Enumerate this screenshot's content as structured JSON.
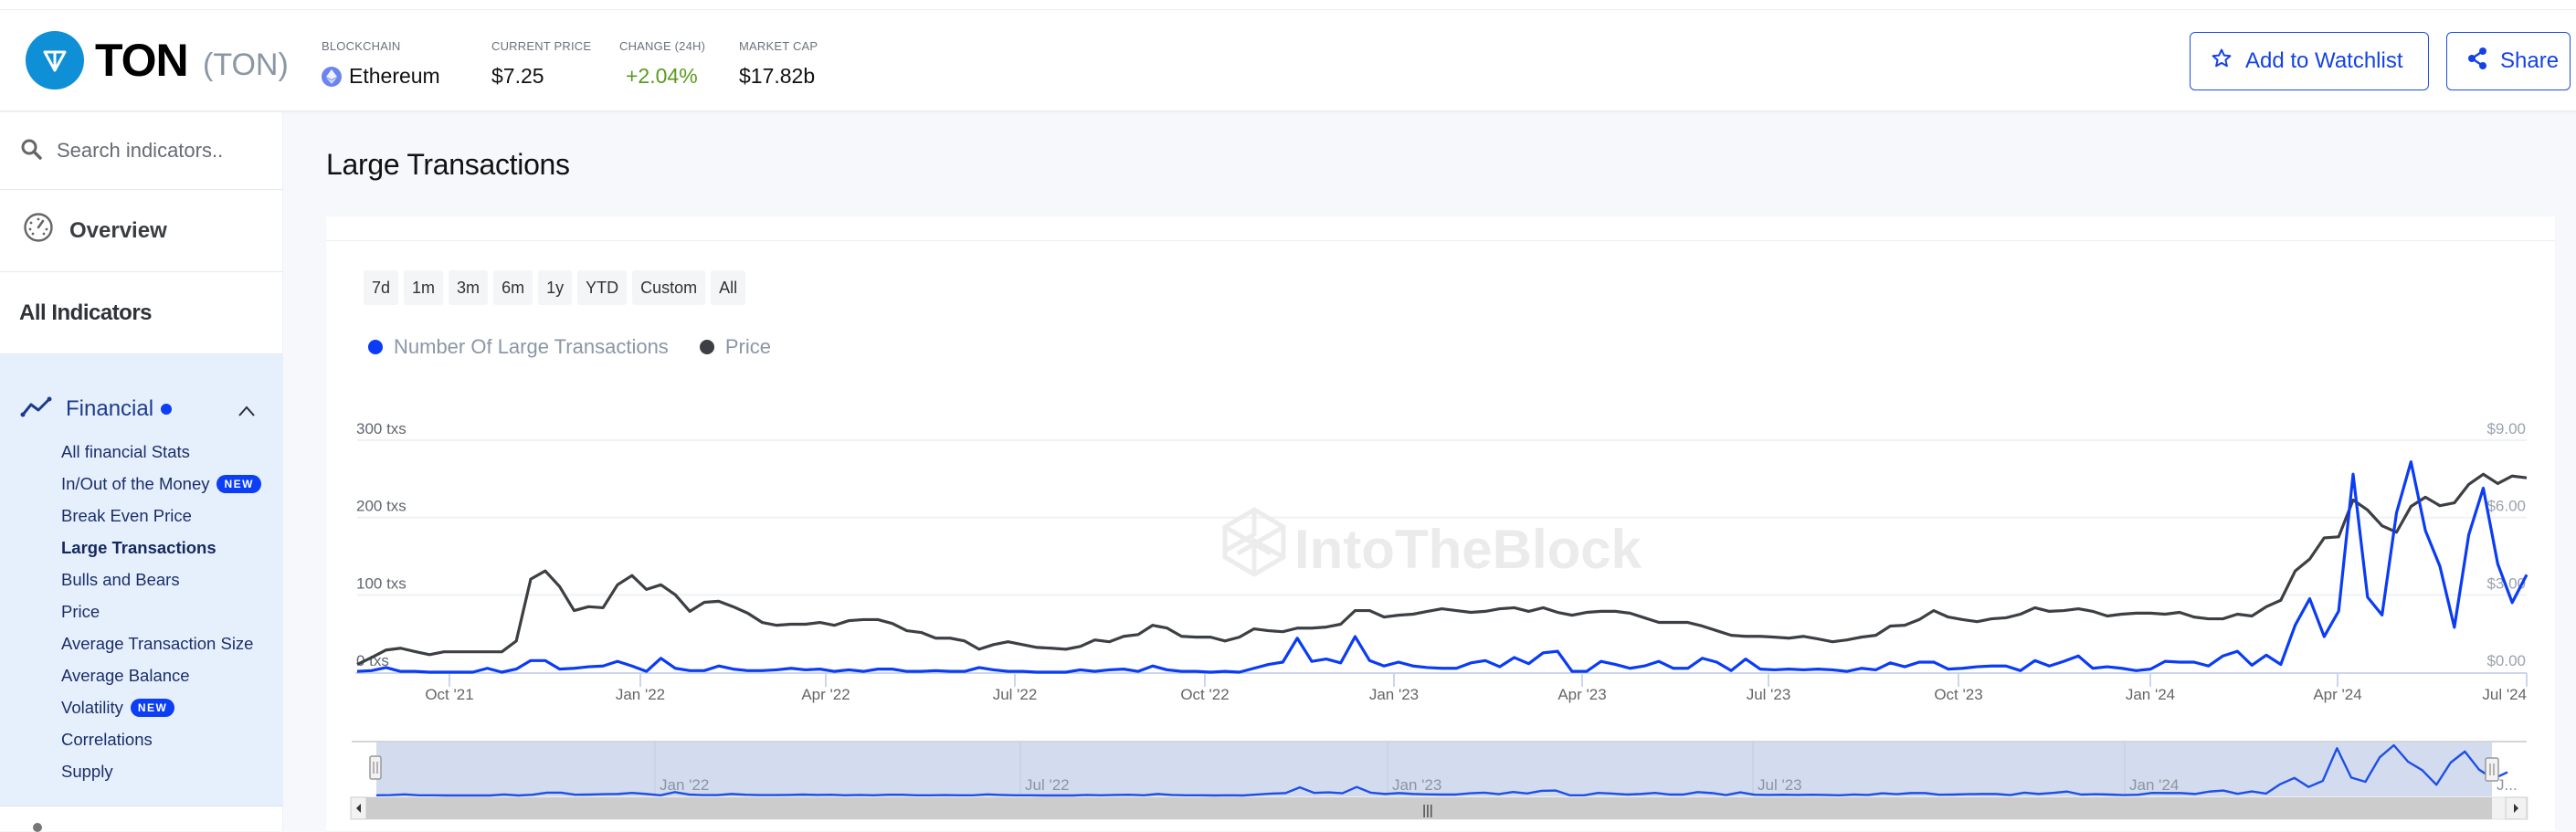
{
  "header": {
    "coin_name": "TON",
    "coin_ticker": "(TON)",
    "stats": [
      {
        "label": "BLOCKCHAIN",
        "value": "Ethereum",
        "icon": "ethereum-icon"
      },
      {
        "label": "CURRENT PRICE",
        "value": "$7.25"
      },
      {
        "label": "CHANGE (24H)",
        "value": "+2.04%",
        "color": "#5b9a1e"
      },
      {
        "label": "MARKET CAP",
        "value": "$17.82b"
      }
    ],
    "watchlist_label": "Add to Watchlist",
    "share_label": "Share",
    "accent": "#1442e6"
  },
  "sidebar": {
    "search_placeholder": "Search indicators..",
    "overview_label": "Overview",
    "all_indicators_label": "All Indicators",
    "group": {
      "label": "Financial",
      "expanded": true,
      "items": [
        {
          "label": "All financial Stats"
        },
        {
          "label": "In/Out of the Money",
          "badge": "NEW"
        },
        {
          "label": "Break Even Price"
        },
        {
          "label": "Large Transactions",
          "active": true
        },
        {
          "label": "Bulls and Bears"
        },
        {
          "label": "Price"
        },
        {
          "label": "Average Transaction Size"
        },
        {
          "label": "Average Balance"
        },
        {
          "label": "Volatility",
          "badge": "NEW"
        },
        {
          "label": "Correlations"
        },
        {
          "label": "Supply"
        }
      ]
    }
  },
  "main": {
    "title": "Large Transactions",
    "ranges": [
      "7d",
      "1m",
      "3m",
      "6m",
      "1y",
      "YTD",
      "Custom",
      "All"
    ],
    "watermark": "IntoTheBlock"
  },
  "chart_data": {
    "type": "line",
    "title": "Large Transactions",
    "x_start": "2021-08-09",
    "x_interval": "weekly",
    "x_tick_labels": [
      "Oct '21",
      "Jan '22",
      "Apr '22",
      "Jul '22",
      "Oct '22",
      "Jan '23",
      "Apr '23",
      "Jul '23",
      "Oct '23",
      "Jan '24",
      "Apr '24",
      "Jul '24"
    ],
    "navigator_labels": [
      "Jan '22",
      "Jul '22",
      "Jan '23",
      "Jul '23",
      "Jan '24",
      "J..."
    ],
    "y_left": {
      "label": "Number Of Large Transactions",
      "ticks": [
        "0 txs",
        "100 txs",
        "200 txs",
        "300 txs"
      ],
      "range": [
        0,
        300
      ]
    },
    "y_right": {
      "label": "Price",
      "ticks": [
        "$0.00",
        "$3.00",
        "$6.00",
        "$9.00"
      ],
      "range": [
        0,
        9
      ]
    },
    "grid": true,
    "legend_position": "top-left",
    "series": [
      {
        "name": "Number Of Large Transactions",
        "axis": "left",
        "color": "#0a3cf5",
        "values": [
          1,
          2,
          6,
          1,
          1,
          0,
          0,
          0,
          0,
          5,
          0,
          4,
          15,
          15,
          4,
          5,
          7,
          8,
          14,
          8,
          1,
          18,
          5,
          2,
          2,
          8,
          4,
          2,
          2,
          3,
          5,
          3,
          4,
          1,
          3,
          1,
          4,
          4,
          1,
          1,
          2,
          1,
          1,
          6,
          3,
          1,
          1,
          0,
          0,
          0,
          3,
          1,
          3,
          4,
          1,
          8,
          3,
          1,
          1,
          0,
          1,
          0,
          5,
          10,
          13,
          44,
          14,
          17,
          12,
          46,
          15,
          8,
          13,
          8,
          6,
          5,
          5,
          12,
          15,
          7,
          19,
          11,
          25,
          27,
          1,
          1,
          14,
          10,
          5,
          8,
          14,
          5,
          5,
          18,
          13,
          2,
          17,
          4,
          3,
          4,
          3,
          4,
          3,
          1,
          5,
          3,
          12,
          7,
          13,
          13,
          4,
          5,
          7,
          8,
          8,
          2,
          15,
          8,
          14,
          21,
          5,
          7,
          5,
          2,
          4,
          14,
          13,
          13,
          8,
          21,
          27,
          9,
          22,
          10,
          61,
          95,
          46,
          79,
          256,
          97,
          74,
          206,
          272,
          183,
          137,
          58,
          178,
          238,
          140,
          90,
          126
        ]
      },
      {
        "name": "Price",
        "axis": "right",
        "color": "#3c3f43",
        "values": [
          0.3,
          0.57,
          0.86,
          0.93,
          0.8,
          0.68,
          0.79,
          0.79,
          0.79,
          0.79,
          0.79,
          1.21,
          3.61,
          3.93,
          3.32,
          2.39,
          2.54,
          2.5,
          3.39,
          3.75,
          3.21,
          3.39,
          3.0,
          2.36,
          2.71,
          2.75,
          2.54,
          2.29,
          1.93,
          1.82,
          1.86,
          1.86,
          1.93,
          1.82,
          2.0,
          2.04,
          2.04,
          1.89,
          1.61,
          1.54,
          1.32,
          1.32,
          1.21,
          0.89,
          1.07,
          1.18,
          1.07,
          0.96,
          0.93,
          0.89,
          1.0,
          1.25,
          1.18,
          1.39,
          1.46,
          1.82,
          1.71,
          1.39,
          1.36,
          1.36,
          1.21,
          1.36,
          1.68,
          1.61,
          1.57,
          1.71,
          1.71,
          1.75,
          1.86,
          2.39,
          2.39,
          2.14,
          2.21,
          2.25,
          2.36,
          2.46,
          2.39,
          2.32,
          2.36,
          2.46,
          2.5,
          2.36,
          2.5,
          2.32,
          2.21,
          2.32,
          2.36,
          2.36,
          2.29,
          2.11,
          1.93,
          1.93,
          1.93,
          1.79,
          1.61,
          1.43,
          1.39,
          1.39,
          1.36,
          1.32,
          1.39,
          1.29,
          1.18,
          1.25,
          1.36,
          1.43,
          1.79,
          1.82,
          2.04,
          2.39,
          2.14,
          2.04,
          1.96,
          2.07,
          2.11,
          2.25,
          2.5,
          2.36,
          2.39,
          2.46,
          2.36,
          2.18,
          2.25,
          2.29,
          2.29,
          2.25,
          2.32,
          2.14,
          2.07,
          2.07,
          2.25,
          2.18,
          2.54,
          2.79,
          3.93,
          4.39,
          5.21,
          5.25,
          6.68,
          6.29,
          5.68,
          5.43,
          6.43,
          6.79,
          6.46,
          6.57,
          7.29,
          7.68,
          7.32,
          7.61,
          7.54
        ]
      }
    ]
  }
}
